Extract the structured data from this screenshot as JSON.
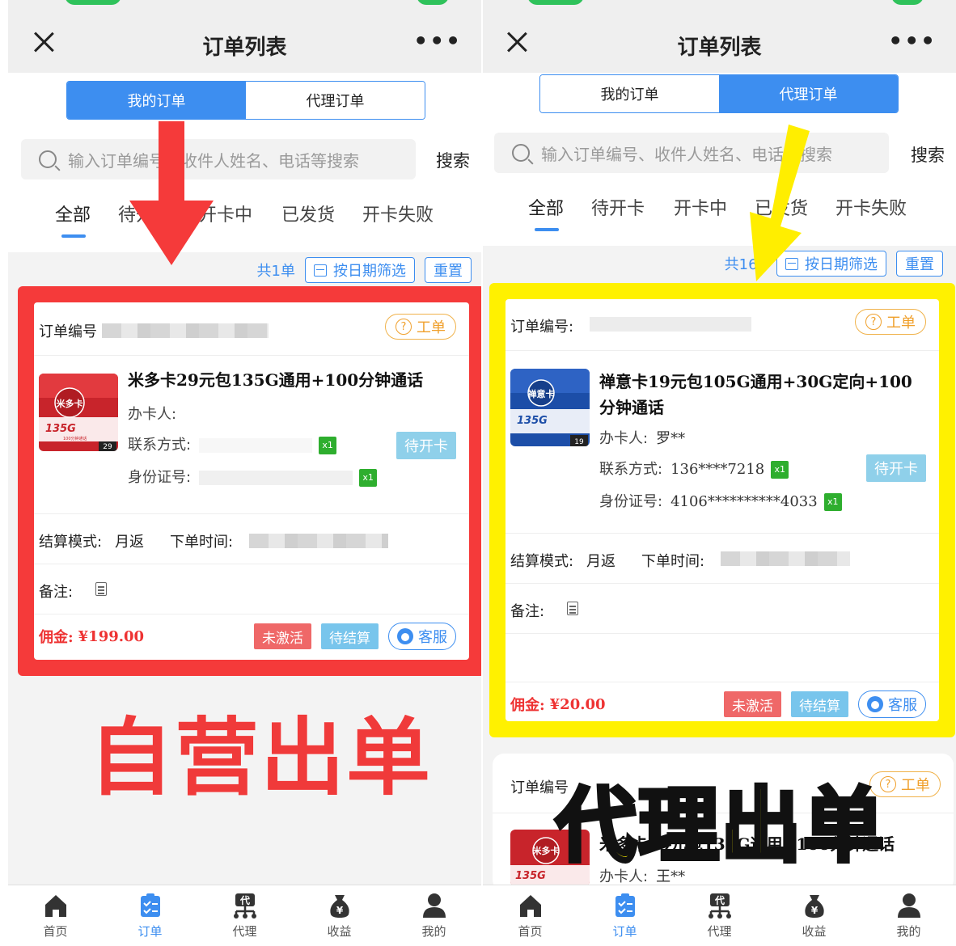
{
  "left": {
    "title": "订单列表",
    "seg": [
      "我的订单",
      "代理订单"
    ],
    "search_placeholder": "输入订单编号、收件人姓名、电话等搜索",
    "search_btn": "搜索",
    "tabs": [
      "全部",
      "待开卡",
      "开卡中",
      "已发货",
      "开卡失败"
    ],
    "count": "共1单",
    "date_filter": "按日期筛选",
    "reset": "重置",
    "order_no_label": "订单编号",
    "ticket": "工单",
    "product_title": "米多卡29元包135G通用+100分钟通话",
    "holder_label": "办卡人:",
    "contact_label": "联系方式:",
    "id_label": "身份证号:",
    "x1": "x1",
    "status": "待开卡",
    "settle_label": "结算模式:",
    "settle_value": "月返",
    "order_time_label": "下单时间:",
    "remark_label": "备注:",
    "commission_label": "佣金:",
    "commission_value": "¥199.00",
    "btn_inactive": "未激活",
    "btn_pending": "待结算",
    "btn_service": "客服",
    "overlay": "自营出单",
    "sim_brand": "米多卡",
    "sim_gb": "135G",
    "sim_sub": "100分钟通话",
    "sim_price": "29"
  },
  "right": {
    "title": "订单列表",
    "seg": [
      "我的订单",
      "代理订单"
    ],
    "search_placeholder": "输入订单编号、收件人姓名、电话等搜索",
    "search_btn": "搜索",
    "tabs": [
      "全部",
      "待开卡",
      "开卡中",
      "已发货",
      "开卡失败"
    ],
    "count": "共162",
    "date_filter": "按日期筛选",
    "reset": "重置",
    "order_no_label": "订单编号:",
    "ticket": "工单",
    "product_title": "禅意卡19元包105G通用+30G定向+100分钟通话",
    "holder_label": "办卡人:",
    "holder_value": "罗**",
    "contact_label": "联系方式:",
    "contact_value": "136****7218",
    "id_label": "身份证号:",
    "id_value": "4106**********4033",
    "x1": "x1",
    "status": "待开卡",
    "settle_label": "结算模式:",
    "settle_value": "月返",
    "order_time_label": "下单时间:",
    "remark_label": "备注:",
    "commission_label": "佣金:",
    "commission_value": "¥20.00",
    "btn_inactive": "未激活",
    "btn_pending": "待结算",
    "btn_service": "客服",
    "second_order_label": "订单编号",
    "second_product": "米多卡29元包135G通用+100分钟通话",
    "second_holder_label": "办卡人:",
    "second_holder_value": "王**",
    "overlay": "代理出单",
    "sim_brand": "禅意卡",
    "sim_gb": "135G",
    "sim_price": "19",
    "sim2_brand": "米多卡",
    "sim2_gb": "135G"
  },
  "nav": [
    "首页",
    "订单",
    "代理",
    "收益",
    "我的"
  ],
  "colors": {
    "accent": "#3d8ef0",
    "red_frame": "#f53a3a",
    "yellow_frame": "#fff100"
  }
}
